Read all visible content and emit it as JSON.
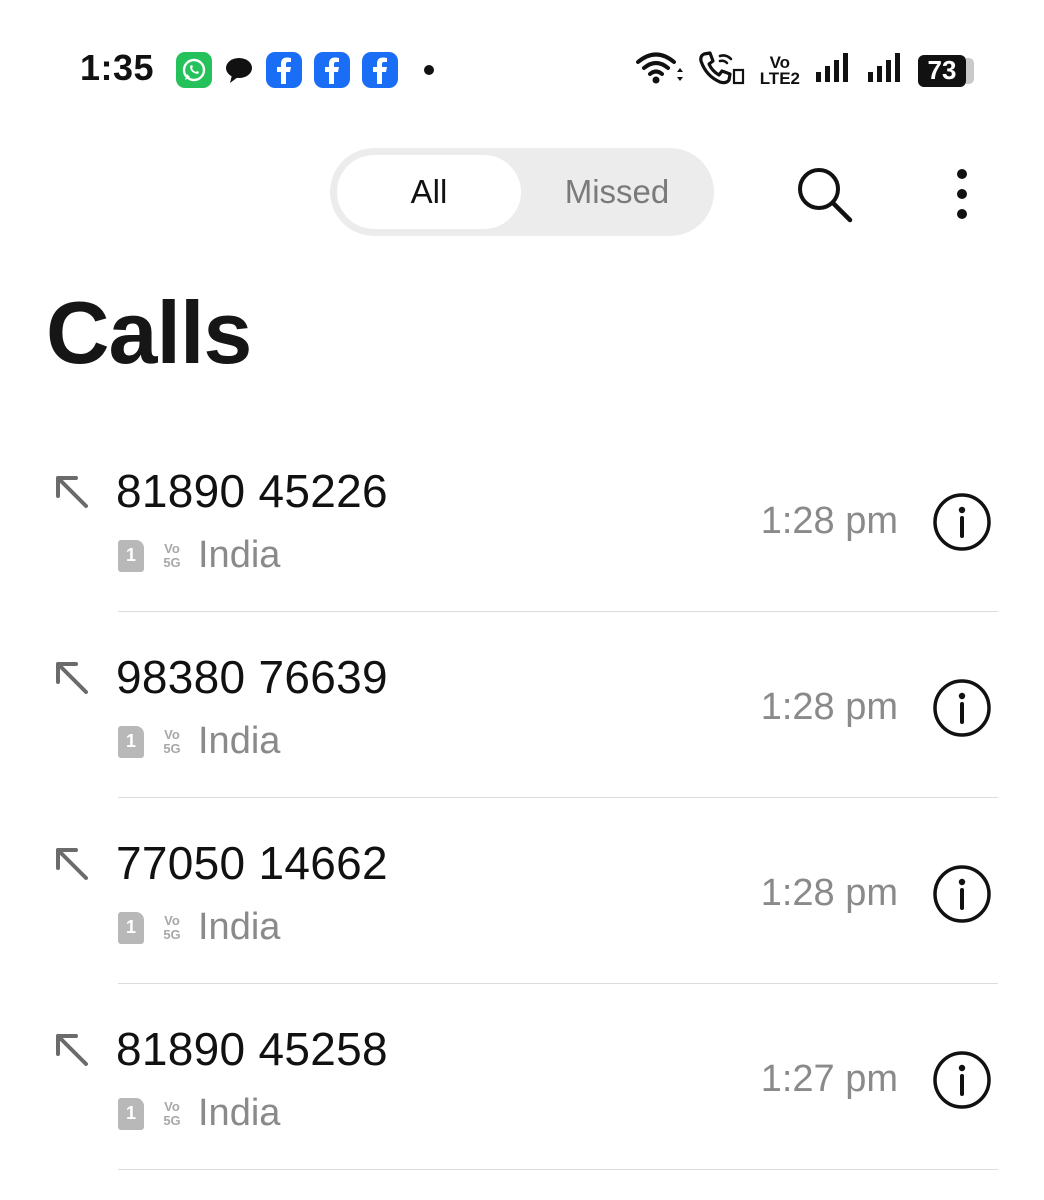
{
  "status_bar": {
    "time": "1:35",
    "notification_icons": [
      "whatsapp-icon",
      "chat-bubble-icon",
      "facebook-icon",
      "facebook-icon",
      "facebook-icon",
      "more-notifications-dot"
    ],
    "system_icons": [
      "wifi-icon",
      "wifi-calling-icon",
      "volte-icon",
      "signal-icon",
      "signal-icon",
      "battery-icon"
    ],
    "volte_label_top": "Vo",
    "volte_label_bottom": "LTE2",
    "battery_level": "73"
  },
  "header": {
    "tabs": [
      {
        "label": "All",
        "selected": true
      },
      {
        "label": "Missed",
        "selected": false
      }
    ],
    "search_icon": "search-icon",
    "more_icon": "more-vertical-icon"
  },
  "page_title": "Calls",
  "calls": [
    {
      "number": "81890 45226",
      "sim": "1",
      "network_top": "Vo",
      "network_bottom": "5G",
      "location": "India",
      "time": "1:28 pm",
      "direction_icon": "outgoing-call-icon"
    },
    {
      "number": "98380 76639",
      "sim": "1",
      "network_top": "Vo",
      "network_bottom": "5G",
      "location": "India",
      "time": "1:28 pm",
      "direction_icon": "outgoing-call-icon"
    },
    {
      "number": "77050 14662",
      "sim": "1",
      "network_top": "Vo",
      "network_bottom": "5G",
      "location": "India",
      "time": "1:28 pm",
      "direction_icon": "outgoing-call-icon"
    },
    {
      "number": "81890 45258",
      "sim": "1",
      "network_top": "Vo",
      "network_bottom": "5G",
      "location": "India",
      "time": "1:27 pm",
      "direction_icon": "outgoing-call-icon"
    }
  ],
  "colors": {
    "whatsapp": "#25c15a",
    "facebook": "#1a6df5",
    "segment_bg": "#ececec",
    "secondary_text": "#8a8a8a",
    "divider": "#dcdcdc"
  }
}
